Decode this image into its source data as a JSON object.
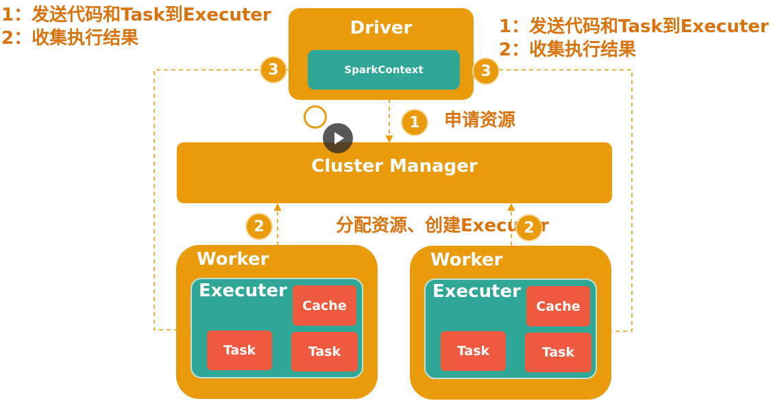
{
  "notes": {
    "left": [
      "1：发送代码和Task到Executer",
      "2：收集执行结果"
    ],
    "right": [
      "1：发送代码和Task到Executer",
      "2：收集执行结果"
    ]
  },
  "driver": {
    "title": "Driver",
    "context": "SparkContext"
  },
  "cluster_manager": {
    "title": "Cluster Manager"
  },
  "labels": {
    "apply": "申请资源",
    "alloc": "分配资源、创建Executer"
  },
  "steps": {
    "one": "1",
    "two": "2",
    "three": "3"
  },
  "workers": [
    {
      "title": "Worker",
      "executer": "Executer",
      "cache": "Cache",
      "tasks": [
        "Task",
        "Task"
      ]
    },
    {
      "title": "Worker",
      "executer": "Executer",
      "cache": "Cache",
      "tasks": [
        "Task",
        "Task"
      ]
    }
  ],
  "colors": {
    "orange": "#ea9b0b",
    "teal": "#2ea796",
    "red": "#ee5a3e",
    "text_orange": "#d9730d"
  },
  "icons": {
    "player": "play-icon"
  }
}
